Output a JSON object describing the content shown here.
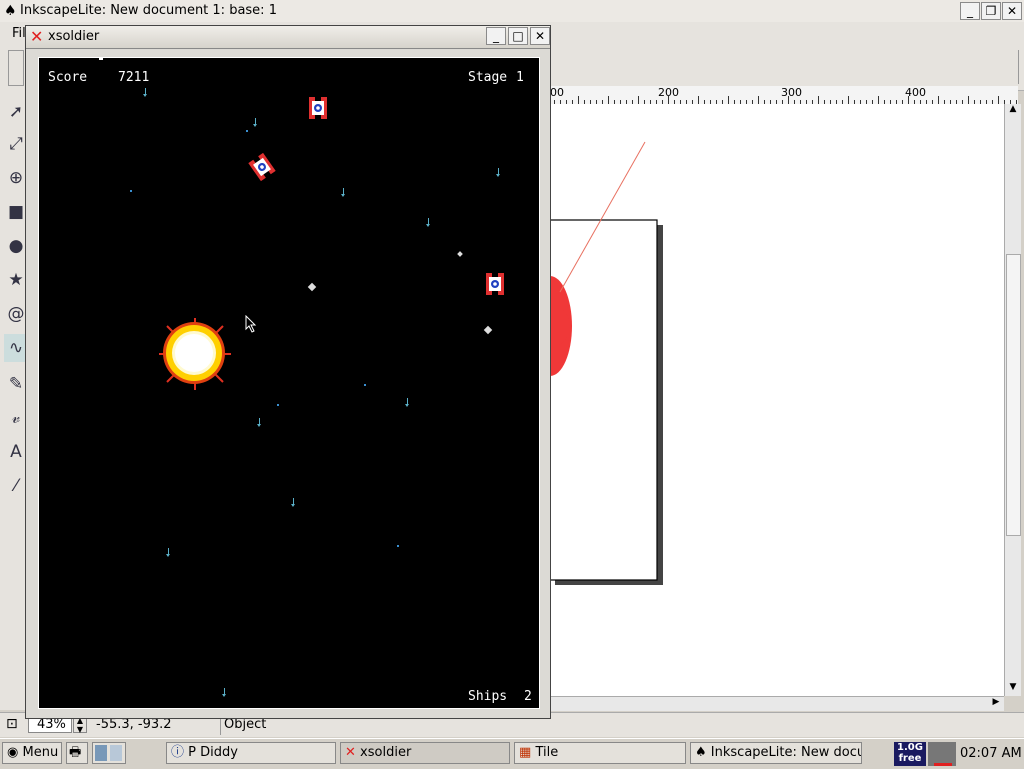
{
  "inkscape": {
    "title": "InkscapeLite: New document 1: base: 1",
    "menu_partial": "Fil",
    "ruler_labels": [
      "00",
      "200",
      "300",
      "400"
    ],
    "zoom": "43%",
    "coords": "-55.3,  -93.2",
    "status": "Object",
    "buttons": {
      "minimize": "_",
      "restore": "❐",
      "close": "✕"
    }
  },
  "xsoldier": {
    "title": "xsoldier",
    "buttons": {
      "minimize": "_",
      "maximize": "□",
      "close": "✕"
    },
    "hud": {
      "score_label": "Score",
      "score": "7211",
      "stage_label": "Stage",
      "stage": "1",
      "ships_label": "Ships",
      "ships": "2"
    }
  },
  "taskbar": {
    "menu_label": "Menu",
    "tasks": [
      {
        "label": "P Diddy",
        "icon": "info-icon"
      },
      {
        "label": "xsoldier",
        "icon": "x-icon"
      },
      {
        "label": "Tile",
        "icon": "tile-icon"
      },
      {
        "label": "InkscapeLite: New docu",
        "icon": "inkscape-icon"
      }
    ],
    "mem_line1": "1.0G",
    "mem_line2": "free",
    "clock": "02:07 AM"
  },
  "colors": {
    "accent_red": "#e03030",
    "game_bg": "#000000",
    "explosion": "#ffd000"
  }
}
